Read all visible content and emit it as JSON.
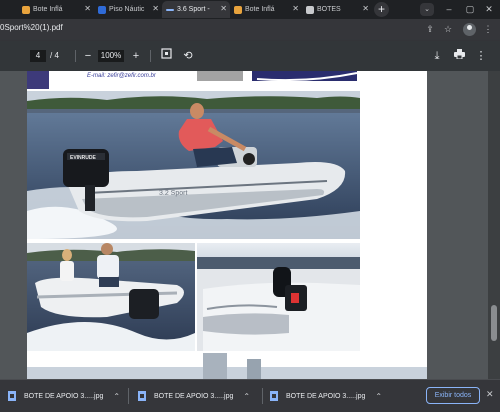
{
  "tabs": [
    {
      "label": "Bote Inflá",
      "active": false
    },
    {
      "label": "Piso Náutic",
      "active": false
    },
    {
      "label": "3.6 Sport -",
      "active": true
    },
    {
      "label": "Bote Inflá",
      "active": false
    },
    {
      "label": "BOTES",
      "active": false
    }
  ],
  "address": {
    "url": "0Sport%20(1).pdf"
  },
  "pdf_toolbar": {
    "current_page": "4",
    "page_separator": "/",
    "total_pages": "4",
    "zoom": "100%"
  },
  "page_content": {
    "email": "E-mail: zefir@zefir.com.br",
    "hull_text": "3.2 Sport",
    "outboard_brand": "EVINRUDE"
  },
  "downloads": [
    {
      "name": "BOTE DE APOIO 3.....jpg"
    },
    {
      "name": "BOTE DE APOIO 3.....jpg"
    },
    {
      "name": "BOTE DE APOIO 3.....jpg"
    }
  ],
  "download_bar": {
    "show_all": "Exibir todos"
  },
  "colors": {
    "accent": "#8ab4f8",
    "tab_strip": "#1f2124",
    "toolbar": "#35363a",
    "viewer": "#525659"
  }
}
